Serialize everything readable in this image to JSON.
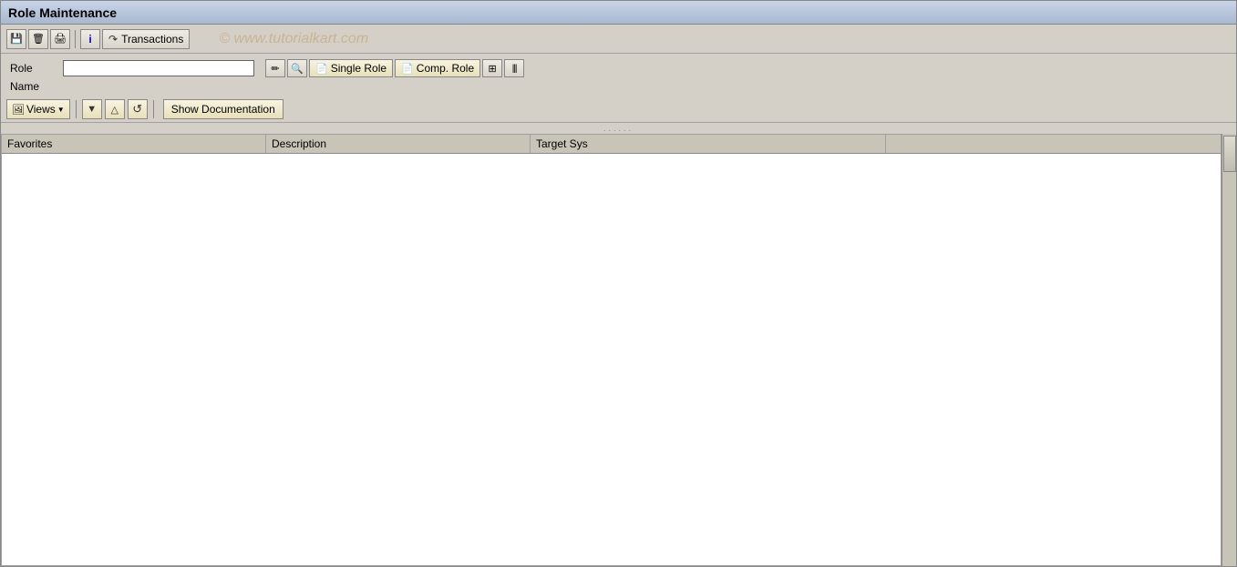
{
  "window": {
    "title": "Role Maintenance"
  },
  "toolbar": {
    "buttons": [
      {
        "name": "save-btn",
        "icon": "save-icon",
        "label": "Save"
      },
      {
        "name": "delete-btn",
        "icon": "delete-icon",
        "label": "Delete"
      },
      {
        "name": "print-btn",
        "icon": "print-icon",
        "label": "Print"
      },
      {
        "name": "info-btn",
        "icon": "info-icon",
        "label": "Info"
      },
      {
        "name": "transactions-btn",
        "label": "Transactions",
        "icon": "transactions-icon"
      }
    ],
    "transactions_label": "Transactions"
  },
  "watermark": {
    "text": "© www.tutorialkart.com"
  },
  "form": {
    "role_label": "Role",
    "name_label": "Name",
    "role_placeholder": "",
    "single_role_label": "Single Role",
    "comp_role_label": "Comp. Role"
  },
  "toolbar2": {
    "views_label": "Views",
    "show_documentation_label": "Show Documentation"
  },
  "table": {
    "columns": [
      {
        "key": "favorites",
        "label": "Favorites"
      },
      {
        "key": "description",
        "label": "Description"
      },
      {
        "key": "target_sys",
        "label": "Target Sys"
      },
      {
        "key": "extra",
        "label": ""
      }
    ],
    "rows": []
  }
}
